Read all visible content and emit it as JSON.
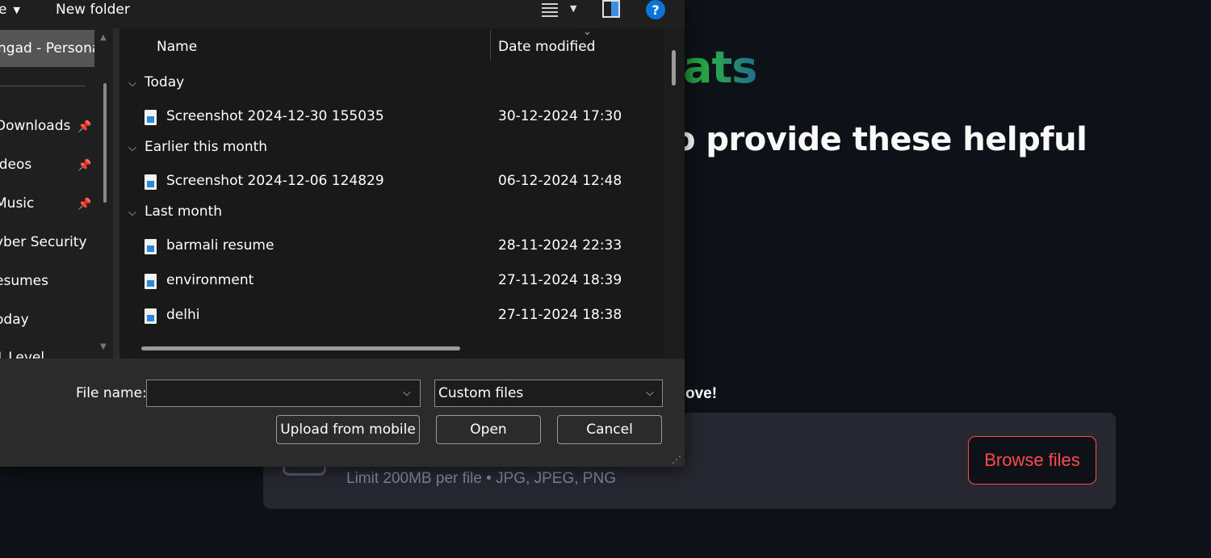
{
  "background_page": {
    "logo_fragment": "ats",
    "heading_fragment": "o provide these helpful",
    "hint_fragment": "ove!",
    "uploader": {
      "limit_text": "Limit 200MB per file • JPG, JPEG, PNG",
      "browse_label": "Browse files"
    }
  },
  "dialog": {
    "toolbar": {
      "organize_label": "e",
      "new_folder_label": "New folder",
      "help_label": "?"
    },
    "nav": {
      "selected": "ngad - Persona",
      "items": [
        {
          "label": "Downloads",
          "pinned": true
        },
        {
          "label": "ideos",
          "pinned": true
        },
        {
          "label": "Music",
          "pinned": true
        },
        {
          "label": "yber Security",
          "pinned": false
        },
        {
          "label": "esumes",
          "pinned": false
        },
        {
          "label": "oday",
          "pinned": false
        },
        {
          "label": "1 Level",
          "pinned": false
        }
      ]
    },
    "columns": {
      "name": "Name",
      "date": "Date modified"
    },
    "groups": [
      {
        "label": "Today",
        "files": [
          {
            "name": "Screenshot 2024-12-30 155035",
            "date": "30-12-2024 17:30"
          }
        ]
      },
      {
        "label": "Earlier this month",
        "files": [
          {
            "name": "Screenshot 2024-12-06 124829",
            "date": "06-12-2024 12:48"
          }
        ]
      },
      {
        "label": "Last month",
        "files": [
          {
            "name": "barmali resume",
            "date": "28-11-2024 22:33"
          },
          {
            "name": "environment",
            "date": "27-11-2024 18:39"
          },
          {
            "name": "delhi",
            "date": "27-11-2024 18:38"
          }
        ]
      }
    ],
    "file_name_label": "File name:",
    "file_name_value": "",
    "file_type_value": "Custom files",
    "buttons": {
      "upload_mobile": "Upload from mobile",
      "open": "Open",
      "cancel": "Cancel"
    }
  },
  "icons": {
    "file": "image-file-icon",
    "pin": "pin-icon",
    "chevron": "chevron-down-icon"
  }
}
